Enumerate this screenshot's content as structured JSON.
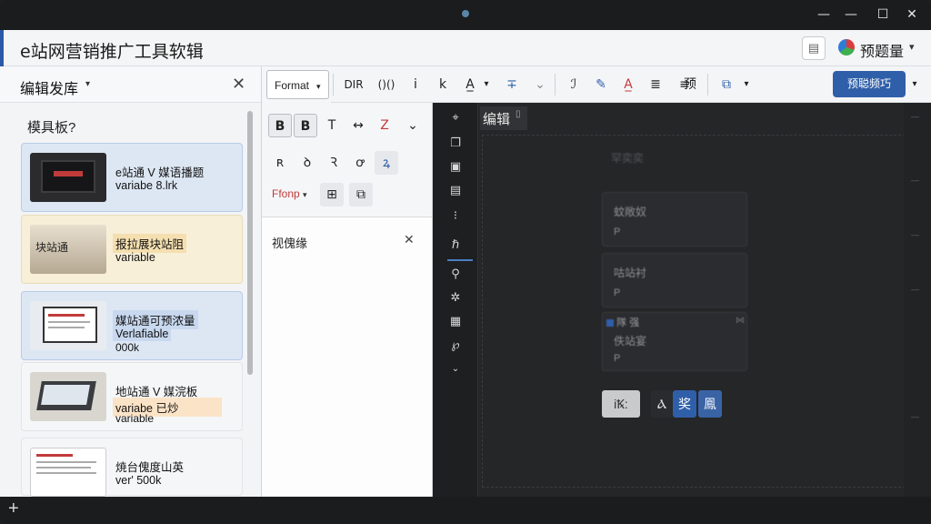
{
  "window": {
    "title": "e站网营销推广工具软辑",
    "controls": {
      "minimize": "—",
      "maximize": "☐",
      "close": "✕"
    }
  },
  "header": {
    "note_icon": "▤",
    "brand_name": "预题量",
    "brand_caret": "▾"
  },
  "left_panel": {
    "title": "编辑发库",
    "caret": "▾",
    "close": "✕",
    "section_label": "模具板?",
    "cards": [
      {
        "line1": "e站通 V 媒语播题",
        "line2": "variabe 8.lrk",
        "line3": "",
        "bg": "#dde7f4",
        "hl": ""
      },
      {
        "line1": "报拉展块站阻",
        "line2": "variable",
        "line3": "",
        "bg": "#f8efd8",
        "hl": "#f5dfb0",
        "thumb_text": "块站通"
      },
      {
        "line1": "媒站通可预浓量",
        "line2": "Verlafiable",
        "line3": "000k",
        "bg": "#dde7f4",
        "hl": "#c8d8ef"
      },
      {
        "line1": "地站通 V 媒浣板",
        "line2": "variabe 已炒",
        "line3": "variable",
        "bg": "#f5f6f8",
        "hl": "#fbe3c7"
      },
      {
        "line1": "焼台傀度山英",
        "line2": "ver' 500k",
        "line3": "",
        "bg": "#f5f6f8",
        "hl": ""
      }
    ]
  },
  "mid_panel": {
    "format_label": "Format",
    "caret": "▾",
    "row1": [
      "B",
      "B",
      "T",
      "↔",
      "Z",
      "⌄"
    ],
    "row2": [
      "ʀ",
      "ꝺ",
      "Ꝛ",
      "ꝍ",
      "ꝝ"
    ],
    "font_label": "Ffonp",
    "sub_title": "视傀缘",
    "sub_close": "✕"
  },
  "toolbar": {
    "tools": [
      "DIR",
      "()()",
      "i",
      "k",
      "A̲",
      "▾",
      "∓",
      "⌄",
      "ℐ",
      "✎",
      "A̲",
      "≣",
      "≡",
      "预",
      "⧉",
      "▾"
    ],
    "primary_label": "预聪频巧",
    "primary_caret": "▾",
    "accent": "#2f5fa8"
  },
  "canvas": {
    "rail_icons": [
      "⌖",
      "❐",
      "▣",
      "▤",
      "⁝",
      "ℏ",
      "⚲",
      "✲",
      "▦",
      "℘",
      "⌄"
    ],
    "editor_tab": "编辑",
    "editor_tab_close": "▯",
    "ghost_text": "罕奕奕",
    "blocks": [
      {
        "title": "蚊敞奴",
        "p": "P",
        "x": ""
      },
      {
        "title": "咕站衬",
        "p": "P",
        "x": ""
      },
      {
        "title": "佚站宴",
        "p": "P",
        "x": "⋈",
        "tag": "隊 强"
      }
    ],
    "bottom_buttons": [
      "iꝄ:",
      "Ⲁ",
      "奖",
      "鳯"
    ],
    "right_chars": [
      "—",
      "—",
      "—",
      "—",
      "—"
    ]
  },
  "statusbar": {
    "plus": "+"
  }
}
